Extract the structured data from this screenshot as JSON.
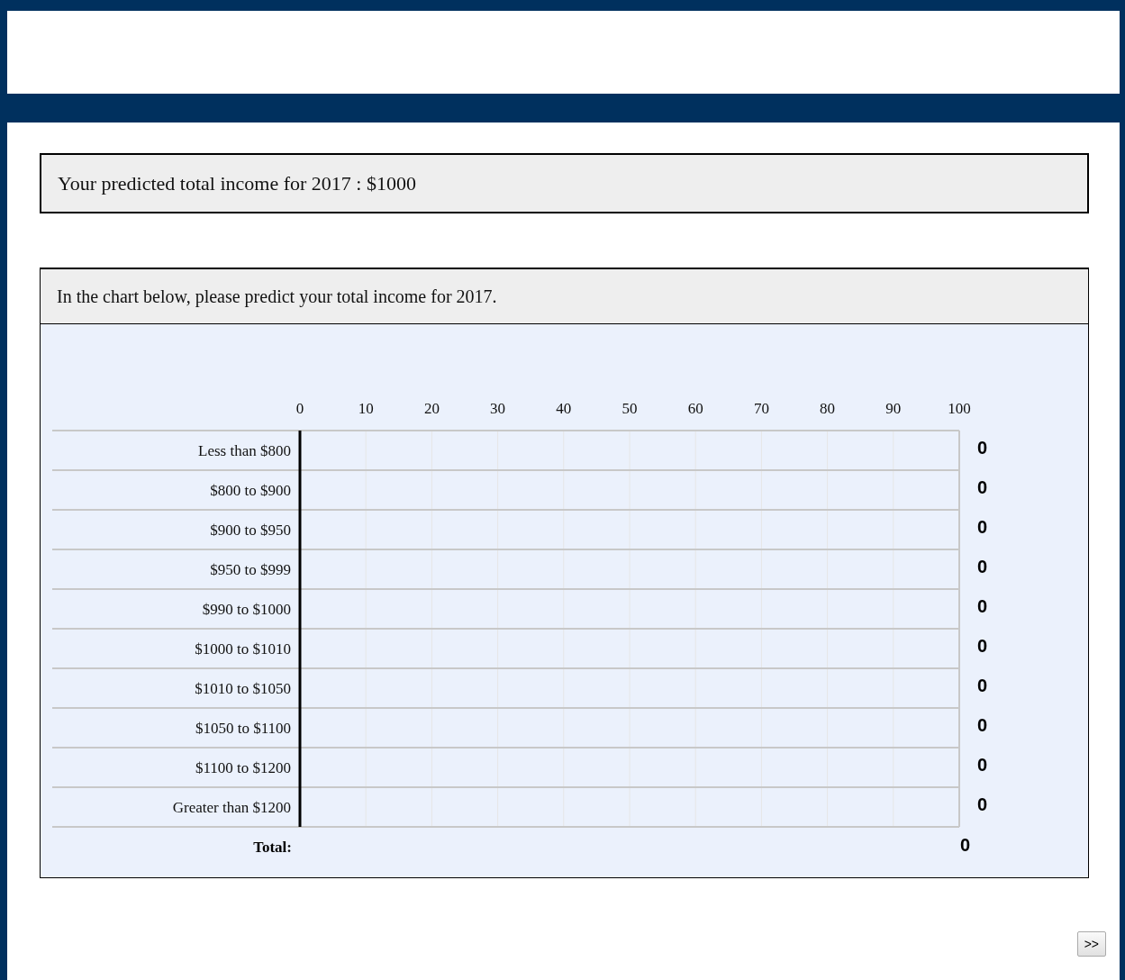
{
  "summary": {
    "text": "Your predicted total income for 2017 : $1000"
  },
  "question": {
    "prompt": "In the chart below, please predict your total income for 2017.",
    "chart_data": {
      "type": "bar",
      "orientation": "horizontal",
      "categories": [
        "Less than $800",
        "$800 to $900",
        "$900 to $950",
        "$950 to $999",
        "$990 to $1000",
        "$1000 to $1010",
        "$1010 to $1050",
        "$1050 to $1100",
        "$1100 to $1200",
        "Greater than $1200"
      ],
      "values": [
        0,
        0,
        0,
        0,
        0,
        0,
        0,
        0,
        0,
        0
      ],
      "xlim": [
        0,
        100
      ],
      "xticks": [
        0,
        10,
        20,
        30,
        40,
        50,
        60,
        70,
        80,
        90,
        100
      ],
      "data_labels": true,
      "grid": true
    },
    "total": {
      "label": "Total:",
      "value": "0"
    }
  },
  "next_button": {
    "label": ">>"
  }
}
